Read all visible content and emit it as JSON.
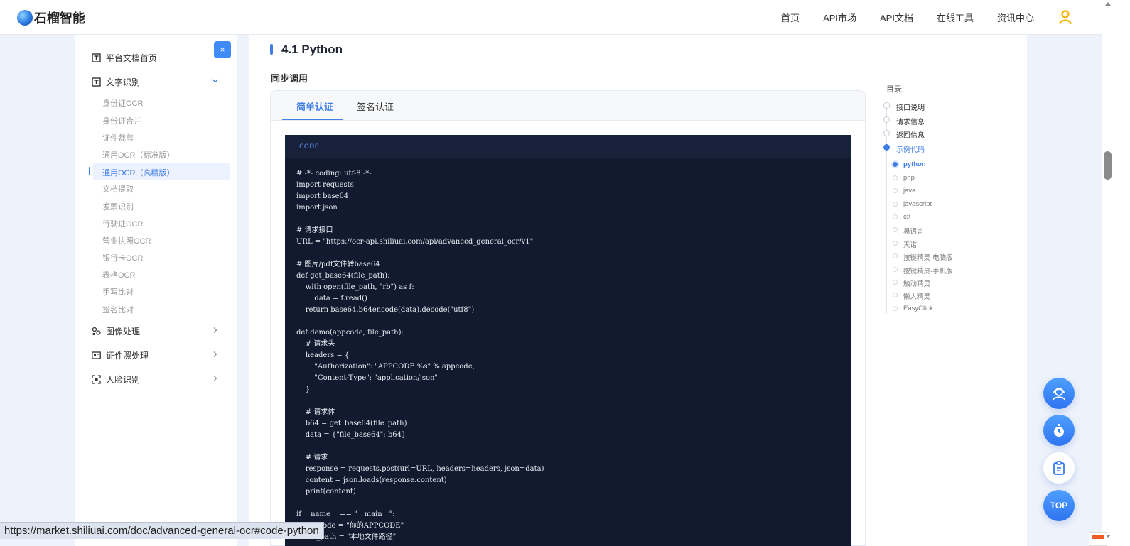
{
  "brand": {
    "name": "石榴智能"
  },
  "nav": {
    "items": [
      "首页",
      "API市场",
      "API文档",
      "在线工具",
      "资讯中心"
    ]
  },
  "sidebar": {
    "close_label": "×",
    "home_label": "平台文档首页",
    "groups": [
      {
        "label": "文字识别",
        "expanded": true
      },
      {
        "label": "图像处理",
        "expanded": false
      },
      {
        "label": "证件照处理",
        "expanded": false
      },
      {
        "label": "人脸识别",
        "expanded": false
      }
    ],
    "ocr_items": [
      "身份证OCR",
      "身份证合并",
      "证件裁剪",
      "通用OCR（标准版）",
      "通用OCR（高精版）",
      "文档提取",
      "发票识别",
      "行驶证OCR",
      "营业执照OCR",
      "银行卡OCR",
      "表格OCR",
      "手写比对",
      "签名比对"
    ],
    "active_item": "通用OCR（高精版）"
  },
  "main": {
    "section_title": "4.1 Python",
    "sub_title": "同步调用",
    "tabs": [
      "简单认证",
      "签名认证"
    ],
    "active_tab": "简单认证",
    "code_tag": "CODE",
    "code": "# -*- coding: utf-8 -*-\nimport requests\nimport base64\nimport json\n\n# 请求接口\nURL = \"https://ocr-api.shiliuai.com/api/advanced_general_ocr/v1\"\n\n# 图片/pdf文件转base64\ndef get_base64(file_path):\n    with open(file_path, \"rb\") as f:\n        data = f.read()\n    return base64.b64encode(data).decode(\"utf8\")\n\ndef demo(appcode, file_path):\n    # 请求头\n    headers = {\n        \"Authorization\": \"APPCODE %s\" % appcode,\n        \"Content-Type\": \"application/json\"\n    }\n\n    # 请求体\n    b64 = get_base64(file_path)\n    data = {\"file_base64\": b64}\n\n    # 请求\n    response = requests.post(url=URL, headers=headers, json=data)\n    content = json.loads(response.content)\n    print(content)\n\nif __name__ == \"__main__\":\n    appcode = \"你的APPCODE\"\n    file_path = \"本地文件路径\""
  },
  "toc": {
    "title": "目录:",
    "items": [
      "接口说明",
      "请求信息",
      "返回信息",
      "示例代码"
    ],
    "active_item": "示例代码",
    "sub_items": [
      "python",
      "php",
      "java",
      "javascript",
      "c#",
      "易语言",
      "天诺",
      "按键精灵-电脑版",
      "按键精灵-手机版",
      "触动精灵",
      "懒人精灵",
      "EasyClick"
    ],
    "active_sub": "python"
  },
  "floating": {
    "top_label": "TOP",
    "icons": [
      "customer-service-icon",
      "stopwatch-icon",
      "clipboard-icon"
    ]
  },
  "status_bar": {
    "url": "https://market.shiliuai.com/doc/advanced-general-ocr#code-python"
  },
  "colors": {
    "accent": "#3f7de8",
    "code_bg": "#111a2e",
    "page_bg": "#eef3fb",
    "user_icon": "#f5b400"
  }
}
